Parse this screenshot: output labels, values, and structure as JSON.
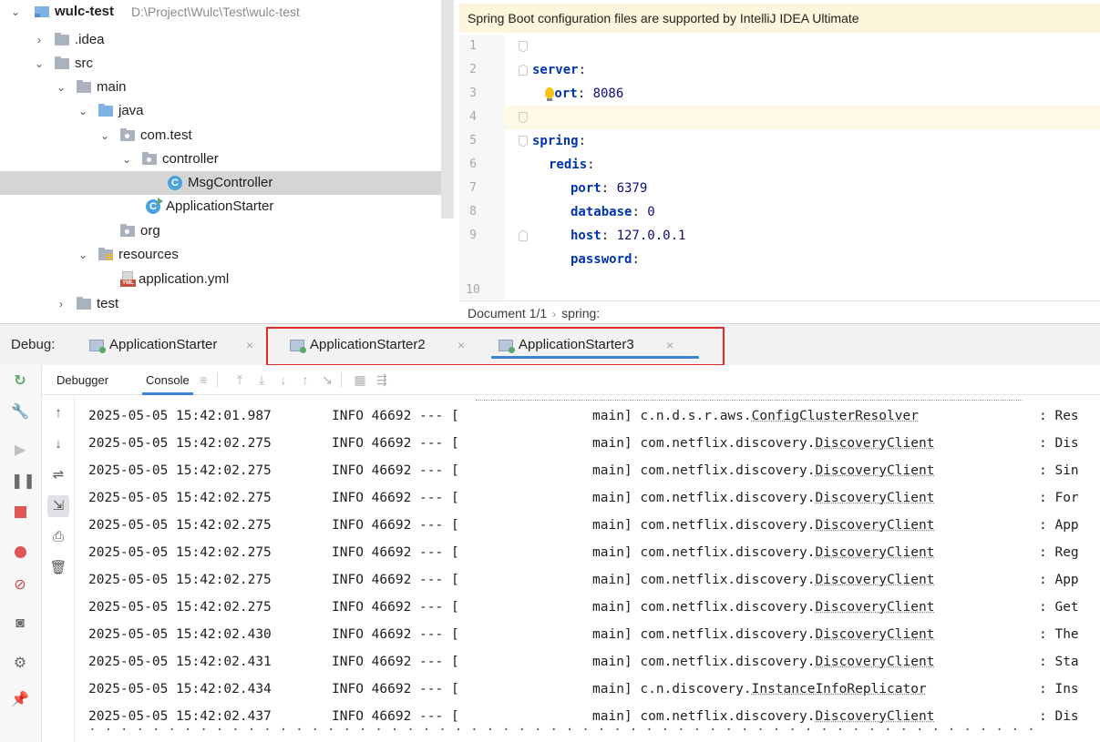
{
  "project": {
    "root": {
      "name": "wulc-test",
      "path": "D:\\Project\\Wulc\\Test\\wulc-test"
    },
    "items": [
      {
        "label": ".idea"
      },
      {
        "label": "src"
      },
      {
        "label": "main"
      },
      {
        "label": "java"
      },
      {
        "label": "com.test"
      },
      {
        "label": "controller"
      },
      {
        "label": "MsgController"
      },
      {
        "label": "ApplicationStarter"
      },
      {
        "label": "org"
      },
      {
        "label": "resources"
      },
      {
        "label": "application.yml"
      },
      {
        "label": "test"
      }
    ],
    "class_icon_letter": "C",
    "yml_icon_text": "YML"
  },
  "editor": {
    "banner": "Spring Boot configuration files are supported by IntelliJ IDEA Ultimate",
    "line_numbers": [
      "1",
      "2",
      "3",
      "4",
      "5",
      "6",
      "7",
      "8",
      "9",
      "10"
    ],
    "lines": [
      {
        "key": "server",
        "sep": ":",
        "value": ""
      },
      {
        "key": "port",
        "sep": ": ",
        "value": "8086"
      },
      {
        "key": "",
        "sep": "",
        "value": ""
      },
      {
        "key": "spring",
        "sep": ":",
        "value": ""
      },
      {
        "key": "redis",
        "sep": ":",
        "value": ""
      },
      {
        "key": "port",
        "sep": ": ",
        "value": "6379"
      },
      {
        "key": "database",
        "sep": ": ",
        "value": "0"
      },
      {
        "key": "host",
        "sep": ": ",
        "value": "127.0.0.1"
      },
      {
        "key": "password",
        "sep": ":",
        "value": ""
      }
    ],
    "breadcrumb": {
      "document": "Document 1/1",
      "separator": "›",
      "path": "spring:"
    }
  },
  "debug": {
    "label": "Debug:",
    "tabs": [
      {
        "label": "ApplicationStarter"
      },
      {
        "label": "ApplicationStarter2"
      },
      {
        "label": "ApplicationStarter3"
      }
    ],
    "close_glyph": "×",
    "subtabs": {
      "debugger": "Debugger",
      "console": "Console"
    }
  },
  "console": {
    "lines": [
      {
        "ts": "2025-05-05 15:42:01.987",
        "lvl": "INFO 46692 --- [",
        "thread": "main]",
        "pkg": "c.n.d.s.r.aws.",
        "cls": "ConfigClusterResolver",
        "msg": ": Res"
      },
      {
        "ts": "2025-05-05 15:42:02.275",
        "lvl": "INFO 46692 --- [",
        "thread": "main]",
        "pkg": "com.netflix.discovery.",
        "cls": "DiscoveryClient",
        "msg": ": Dis"
      },
      {
        "ts": "2025-05-05 15:42:02.275",
        "lvl": "INFO 46692 --- [",
        "thread": "main]",
        "pkg": "com.netflix.discovery.",
        "cls": "DiscoveryClient",
        "msg": ": Sin"
      },
      {
        "ts": "2025-05-05 15:42:02.275",
        "lvl": "INFO 46692 --- [",
        "thread": "main]",
        "pkg": "com.netflix.discovery.",
        "cls": "DiscoveryClient",
        "msg": ": For"
      },
      {
        "ts": "2025-05-05 15:42:02.275",
        "lvl": "INFO 46692 --- [",
        "thread": "main]",
        "pkg": "com.netflix.discovery.",
        "cls": "DiscoveryClient",
        "msg": ": App"
      },
      {
        "ts": "2025-05-05 15:42:02.275",
        "lvl": "INFO 46692 --- [",
        "thread": "main]",
        "pkg": "com.netflix.discovery.",
        "cls": "DiscoveryClient",
        "msg": ": Reg"
      },
      {
        "ts": "2025-05-05 15:42:02.275",
        "lvl": "INFO 46692 --- [",
        "thread": "main]",
        "pkg": "com.netflix.discovery.",
        "cls": "DiscoveryClient",
        "msg": ": App"
      },
      {
        "ts": "2025-05-05 15:42:02.275",
        "lvl": "INFO 46692 --- [",
        "thread": "main]",
        "pkg": "com.netflix.discovery.",
        "cls": "DiscoveryClient",
        "msg": ": Get"
      },
      {
        "ts": "2025-05-05 15:42:02.430",
        "lvl": "INFO 46692 --- [",
        "thread": "main]",
        "pkg": "com.netflix.discovery.",
        "cls": "DiscoveryClient",
        "msg": ": The"
      },
      {
        "ts": "2025-05-05 15:42:02.431",
        "lvl": "INFO 46692 --- [",
        "thread": "main]",
        "pkg": "com.netflix.discovery.",
        "cls": "DiscoveryClient",
        "msg": ": Sta"
      },
      {
        "ts": "2025-05-05 15:42:02.434",
        "lvl": "INFO 46692 --- [",
        "thread": "main]",
        "pkg": "c.n.discovery.",
        "cls": "InstanceInfoReplicator",
        "msg": ": Ins"
      },
      {
        "ts": "2025-05-05 15:42:02.437",
        "lvl": "INFO 46692 --- [",
        "thread": "main]",
        "pkg": "com.netflix.discovery.",
        "cls": "DiscoveryClient",
        "msg": ": Dis"
      }
    ]
  },
  "colors": {
    "accent": "#3d82d6",
    "highlight_border": "#e02b2b",
    "yaml_key": "#0033b3",
    "banner_bg": "#fdf6dc",
    "selection": "#d5d5d5"
  }
}
